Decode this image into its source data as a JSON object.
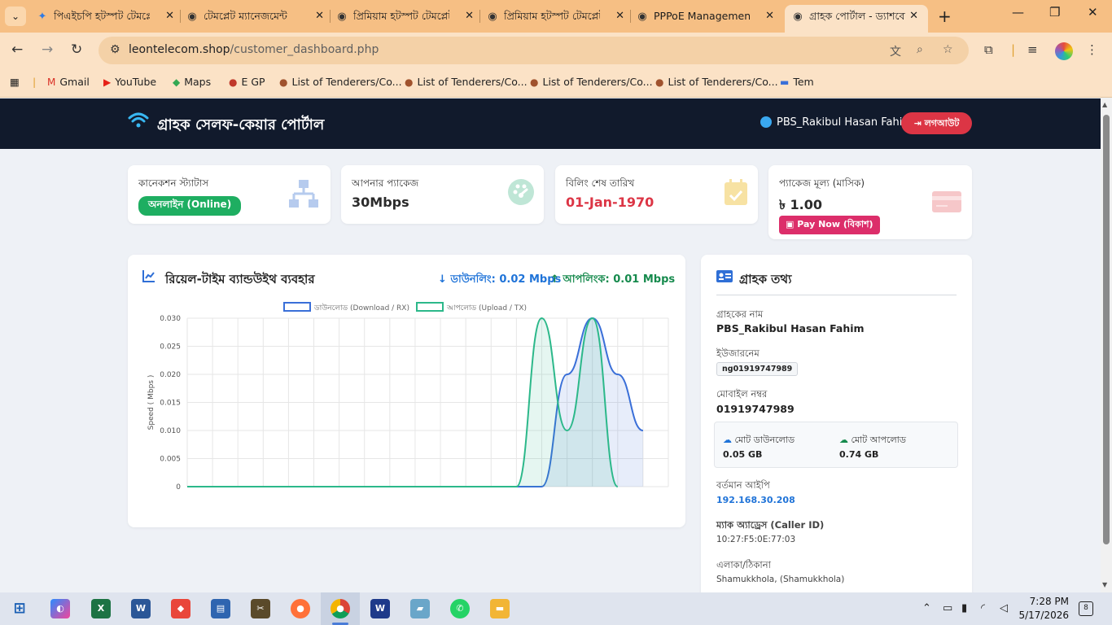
{
  "browser": {
    "tabs": [
      {
        "label": "পিএইচপি হটস্পট টেমপ্লেট",
        "icon": "star-icon"
      },
      {
        "label": "টেমপ্লেট ম্যানেজমেন্ট",
        "icon": "globe-icon"
      },
      {
        "label": "প্রিমিয়াম হটস্পট টেমপ্লেট",
        "icon": "globe-icon"
      },
      {
        "label": "প্রিমিয়াম হটস্পট টেমপ্লেট",
        "icon": "globe-icon"
      },
      {
        "label": "PPPoE Management |",
        "icon": "globe-icon"
      },
      {
        "label": "গ্রাহক পোর্টাল - ড্যাশবোর্ড",
        "icon": "globe-icon",
        "active": true
      }
    ],
    "address": {
      "domain": "leontelecom.shop",
      "path": "/customer_dashboard.php"
    },
    "bookmarks": [
      "Gmail",
      "YouTube",
      "Maps",
      "E GP",
      "List of Tenderers/Co...",
      "List of Tenderers/Co...",
      "List of Tenderers/Co...",
      "List of Tenderers/Co...",
      "Tem"
    ]
  },
  "header": {
    "brand": "গ্রাহক সেলফ-কেয়ার পোর্টাল",
    "user": "PBS_Rakibul Hasan Fahim",
    "logout_label": "লগআউট"
  },
  "stats": {
    "connection": {
      "title": "কানেকশন স্ট্যাটাস",
      "value": "অনলাইন (Online)"
    },
    "package": {
      "title": "আপনার প্যাকেজ",
      "value": "30Mbps"
    },
    "billing": {
      "title": "বিলিং শেষ তারিখ",
      "value": "01-Jan-1970"
    },
    "price": {
      "title": "প্যাকেজ মূল্য (মাসিক)",
      "value": "৳ 1.00",
      "pay_label": "Pay Now (বিকাশ)"
    }
  },
  "chart": {
    "title": "রিয়েল-টাইম ব্যান্ডউইথ ব্যবহার",
    "dl_label": "ডাউনলিং: 0.02 Mbps",
    "ul_label": "আপলিংক: 0.01 Mbps"
  },
  "chart_data": {
    "type": "line",
    "ylabel": "Speed ( Mbps )",
    "xlabel": "",
    "ylim": [
      0,
      0.03
    ],
    "yticks": [
      "0",
      "0.005",
      "0.010",
      "0.015",
      "0.020",
      "0.025",
      "0.030"
    ],
    "grid": true,
    "legend_position": "top",
    "x": [
      0,
      1,
      2,
      3,
      4,
      5,
      6,
      7,
      8,
      9,
      10,
      11,
      12,
      13,
      14,
      15,
      16,
      17,
      18,
      19
    ],
    "series": [
      {
        "name": "ডাউনলোড (Download / RX)",
        "color": "#3a6fd8",
        "values": [
          0,
          0,
          0,
          0,
          0,
          0,
          0,
          0,
          0,
          0,
          0,
          0,
          0,
          0,
          0,
          0.02,
          0.03,
          0.02,
          0.01,
          null
        ]
      },
      {
        "name": "আপলোড (Upload / TX)",
        "color": "#2cb88a",
        "values": [
          0,
          0,
          0,
          0,
          0,
          0,
          0,
          0,
          0,
          0,
          0,
          0,
          0,
          0,
          0.03,
          0.01,
          0.03,
          0,
          null,
          null
        ]
      }
    ]
  },
  "info": {
    "title": "গ্রাহক তথ্য",
    "fields": {
      "name_label": "গ্রাহকের নাম",
      "name": "PBS_Rakibul Hasan Fahim",
      "username_label": "ইউজারনেম",
      "username": "ng01919747989",
      "mobile_label": "মোবাইল নম্বর",
      "mobile": "01919747989",
      "download_label": "মোট ডাউনলোড",
      "download": "0.05 GB",
      "upload_label": "মোট আপলোড",
      "upload": "0.74 GB",
      "ip_label": "বর্তমান আইপি",
      "ip": "192.168.30.208",
      "mac_label": "ম্যাক অ্যাড্রেস (Caller ID)",
      "mac": "10:27:F5:0E:77:03",
      "address_label": "এলাকা/ঠিকানা",
      "address": "Shamukkhola, (Shamukkhola)"
    }
  },
  "taskbar": {
    "time": "7:28 PM",
    "date": "5/17/2026",
    "notifications": "8"
  }
}
